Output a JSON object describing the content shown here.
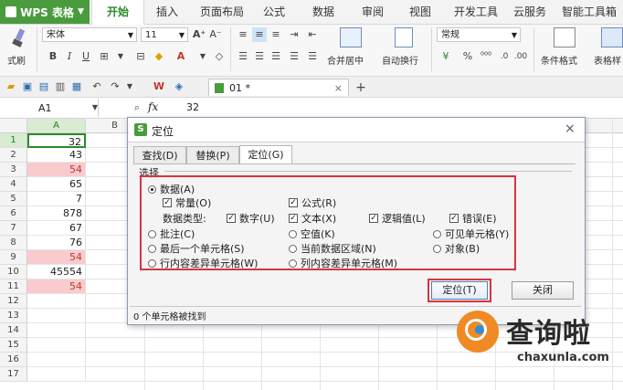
{
  "app": {
    "title": "WPS 表格"
  },
  "tabs": [
    "开始",
    "插入",
    "页面布局",
    "公式",
    "数据",
    "审阅",
    "视图",
    "开发工具",
    "云服务",
    "智能工具箱"
  ],
  "ribbon": {
    "format_painter": "式刷",
    "font_name": "宋体",
    "font_size": "11",
    "number_format": "常规",
    "merge_center": "合并居中",
    "wrap_text": "自动换行",
    "cond_format": "条件格式",
    "table_style": "表格样"
  },
  "doc_tab": {
    "name": "01 *"
  },
  "formula_bar": {
    "cell_ref": "A1",
    "fx": "fx",
    "value": "32"
  },
  "columns": [
    "A",
    "B"
  ],
  "rows": [
    {
      "num": "1",
      "value": "32",
      "highlight": false
    },
    {
      "num": "2",
      "value": "43",
      "highlight": false
    },
    {
      "num": "3",
      "value": "54",
      "highlight": true
    },
    {
      "num": "4",
      "value": "65",
      "highlight": false
    },
    {
      "num": "5",
      "value": "7",
      "highlight": false
    },
    {
      "num": "6",
      "value": "878",
      "highlight": false
    },
    {
      "num": "7",
      "value": "67",
      "highlight": false
    },
    {
      "num": "8",
      "value": "76",
      "highlight": false
    },
    {
      "num": "9",
      "value": "54",
      "highlight": true
    },
    {
      "num": "10",
      "value": "45554",
      "highlight": false
    },
    {
      "num": "11",
      "value": "54",
      "highlight": true
    },
    {
      "num": "12",
      "value": "",
      "highlight": false
    },
    {
      "num": "13",
      "value": "",
      "highlight": false
    },
    {
      "num": "14",
      "value": "",
      "highlight": false
    },
    {
      "num": "15",
      "value": "",
      "highlight": false
    },
    {
      "num": "16",
      "value": "",
      "highlight": false
    },
    {
      "num": "17",
      "value": "",
      "highlight": false
    }
  ],
  "dialog": {
    "title": "定位",
    "tabs": [
      "查找(D)",
      "替换(P)",
      "定位(G)"
    ],
    "section": "选择",
    "opt_data": "数据(A)",
    "opt_constant": "常量(O)",
    "opt_formula": "公式(R)",
    "data_type_label": "数据类型:",
    "type_number": "数字(U)",
    "type_text": "文本(X)",
    "type_logic": "逻辑值(L)",
    "type_error": "错误(E)",
    "opt_comment": "批注(C)",
    "opt_blank": "空值(K)",
    "opt_visible": "可见单元格(Y)",
    "opt_last_cell": "最后一个单元格(S)",
    "opt_current_region": "当前数据区域(N)",
    "opt_object": "对象(B)",
    "opt_row_diff": "行内容差异单元格(W)",
    "opt_col_diff": "列内容差异单元格(M)",
    "btn_locate": "定位(T)",
    "btn_close": "关闭",
    "status": "0 个单元格被找到"
  },
  "watermark": {
    "text": "查询啦",
    "url": "chaxunla.com"
  },
  "colors": {
    "accent": "#4a9b3d",
    "highlight": "#f9cbcf",
    "red_box": "#d9343b"
  }
}
